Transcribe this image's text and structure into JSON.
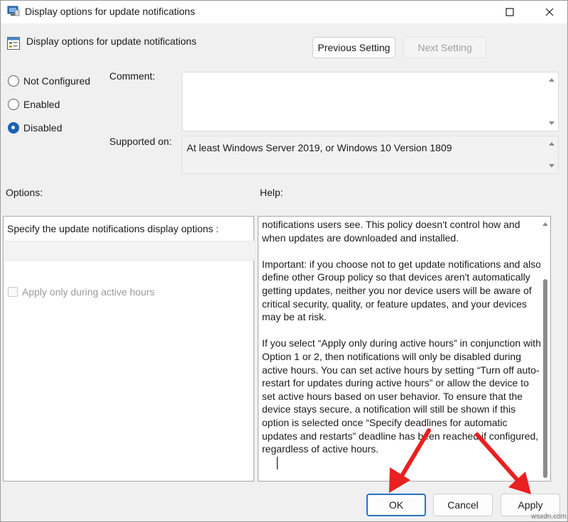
{
  "window": {
    "title": "Display options for update notifications"
  },
  "header": {
    "title": "Display options for update notifications",
    "prev_label": "Previous Setting",
    "next_label": "Next Setting"
  },
  "state": {
    "options": [
      {
        "label": "Not Configured",
        "checked": false
      },
      {
        "label": "Enabled",
        "checked": false
      },
      {
        "label": "Disabled",
        "checked": true
      }
    ]
  },
  "comment": {
    "label": "Comment:",
    "value": ""
  },
  "supported": {
    "label": "Supported on:",
    "value": "At least Windows Server 2019, or Windows 10 Version 1809"
  },
  "options_panel": {
    "label": "Options:",
    "field_label": "Specify the update notifications display options :",
    "checkbox_label": "Apply only during active hours"
  },
  "help_panel": {
    "label": "Help:",
    "paragraphs": [
      "notifications users see. This policy doesn't control how and when updates are downloaded and installed.",
      "Important: if you choose not to get update notifications and also define other Group policy so that devices aren't automatically getting updates, neither you nor device users will be aware of critical security, quality, or feature updates, and your devices may be at risk.",
      "If you select “Apply only during active hours” in conjunction with Option 1 or 2, then notifications will only be disabled during active hours. You can set active hours by setting “Turn off auto-restart for updates during active hours” or allow the device to set active hours based on user behavior. To ensure that the device stays secure, a notification will still be shown if this option is selected once “Specify deadlines for automatic updates and restarts” deadline has been reached if configured, regardless of active hours."
    ]
  },
  "footer": {
    "ok_label": "OK",
    "cancel_label": "Cancel",
    "apply_label": "Apply"
  },
  "watermark": "wsxdn.com",
  "colors": {
    "accent": "#1c5fb8",
    "annotation_arrow": "#e8201f"
  }
}
